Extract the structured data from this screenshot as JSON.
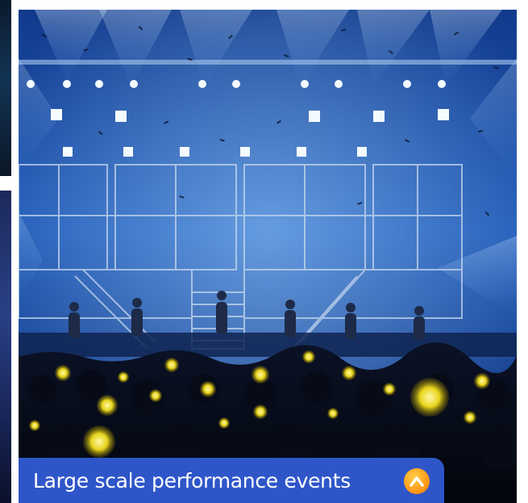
{
  "gallery": {
    "caption": "Large scale performance events",
    "caption_icon": "chevron-up-icon",
    "photo_subject": "concert-stage-photo",
    "colors": {
      "caption_bg": "#2f56c9",
      "caption_text": "#ffffff",
      "icon_bg": "#ff9f1a",
      "icon_glyph": "#ffffff"
    }
  }
}
